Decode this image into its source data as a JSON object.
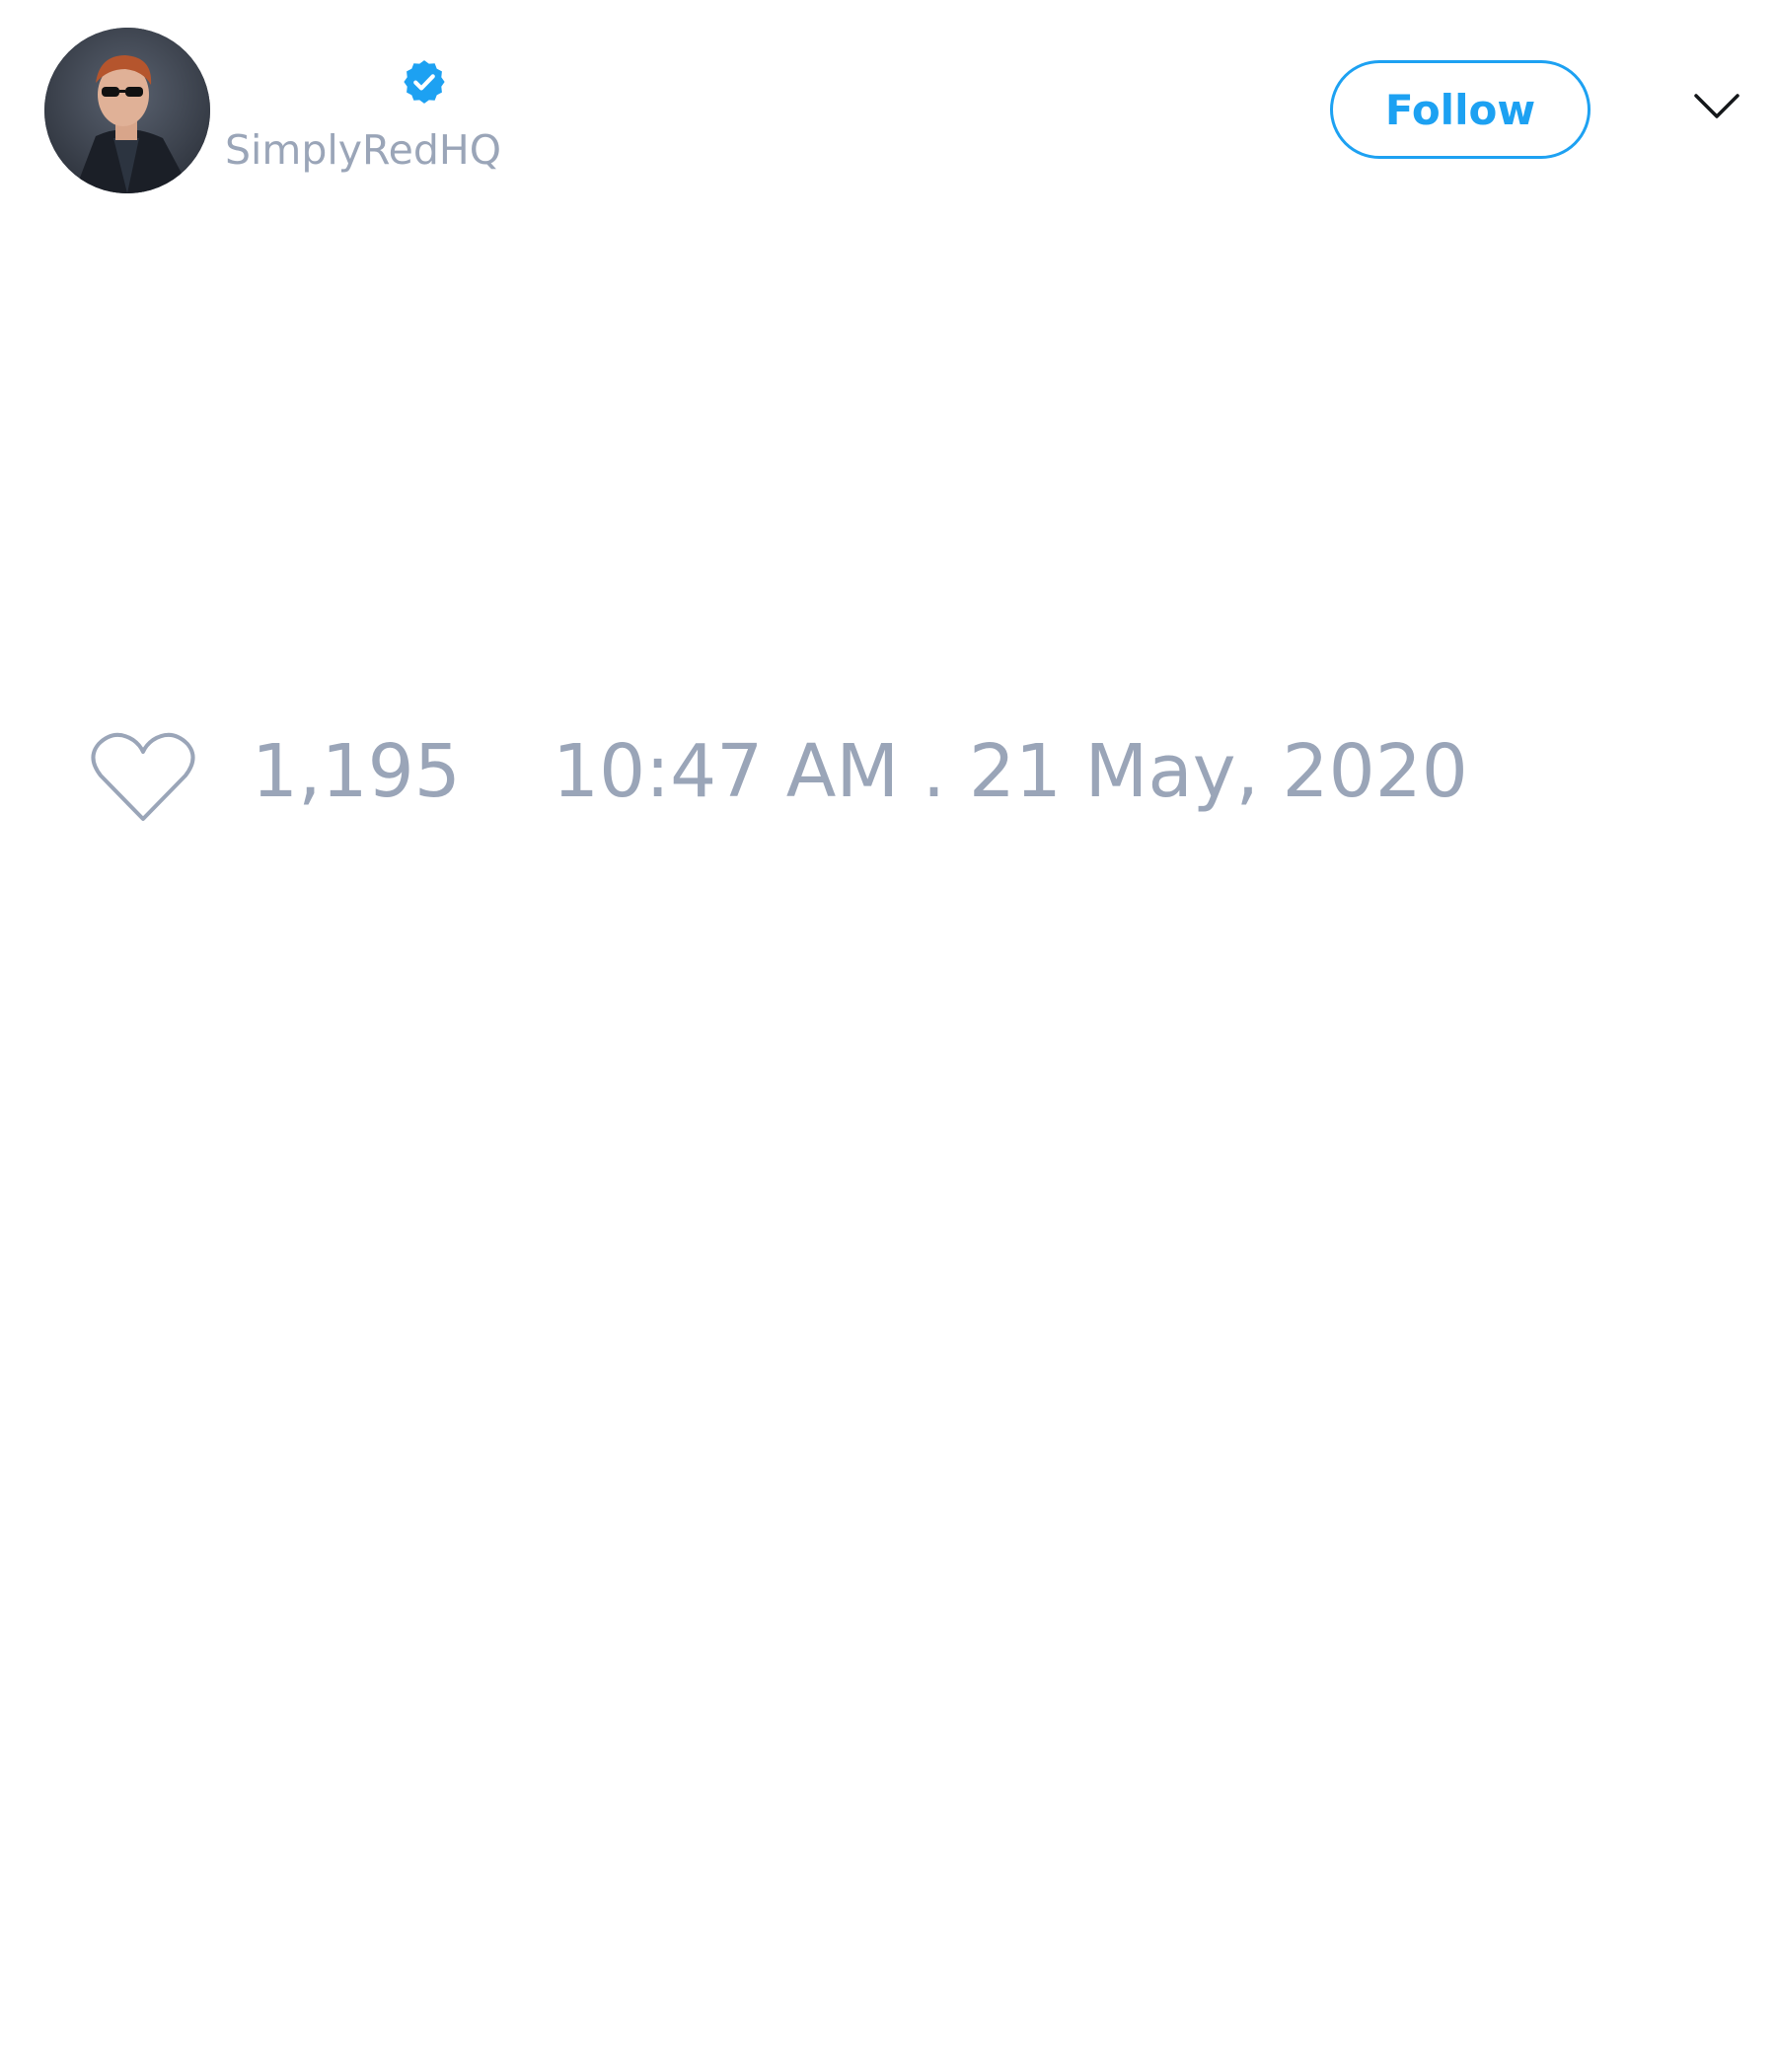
{
  "tweet": {
    "author": {
      "handle": "SimplyRedHQ",
      "verified": true,
      "avatar_icon": "user-avatar-photo"
    },
    "follow_label": "Follow",
    "menu_icon": "chevron-down-icon",
    "likes": {
      "icon": "heart-icon",
      "count": "1,195"
    },
    "timestamp": "10:47 AM . 21 May, 2020"
  },
  "colors": {
    "accent": "#1da1f2",
    "muted_text": "#9aa5b8",
    "background": "#ffffff"
  }
}
